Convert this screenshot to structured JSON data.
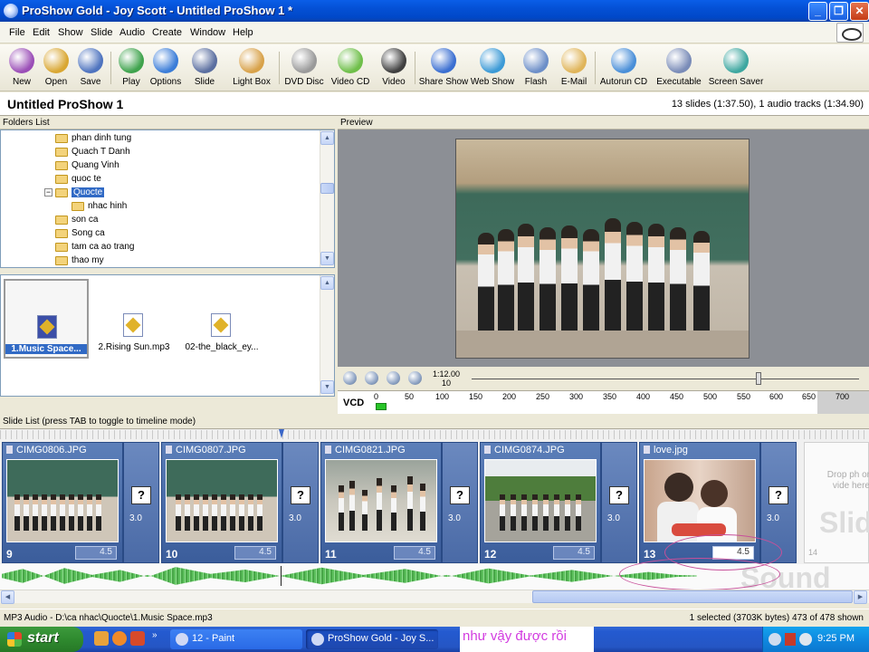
{
  "window": {
    "title": "ProShow Gold - Joy Scott - Untitled ProShow 1 *",
    "controls": [
      "_",
      "❐",
      "✕"
    ]
  },
  "menu": [
    "File",
    "Edit",
    "Show",
    "Slide",
    "Audio",
    "Create",
    "Window",
    "Help"
  ],
  "toolbar": [
    {
      "label": "New",
      "icon": "new-icon",
      "color": "#9b4fb7"
    },
    {
      "label": "Open",
      "icon": "open-folder-icon",
      "color": "#d9a733"
    },
    {
      "label": "Save",
      "icon": "save-icon",
      "color": "#4f74bf"
    },
    {
      "label": "Play",
      "icon": "play-icon",
      "color": "#3fa34d"
    },
    {
      "label": "Options",
      "icon": "options-globe-icon",
      "color": "#3b7dd8"
    },
    {
      "label": "Slide",
      "icon": "slide-filmstrip-icon",
      "color": "#5b6fa0"
    },
    {
      "label": "Light Box",
      "icon": "light-box-icon",
      "color": "#d8a24a"
    },
    {
      "label": "DVD Disc",
      "icon": "dvd-disc-icon",
      "color": "#9a9a9a"
    },
    {
      "label": "Video CD",
      "icon": "video-cd-icon",
      "color": "#6fbf4a"
    },
    {
      "label": "Video",
      "icon": "video-icon",
      "color": "#404040"
    },
    {
      "label": "Share Show",
      "icon": "share-show-icon",
      "color": "#3b6fd1"
    },
    {
      "label": "Web Show",
      "icon": "web-show-icon",
      "color": "#3c9ad6"
    },
    {
      "label": "Flash",
      "icon": "flash-icon",
      "color": "#6d8fc8"
    },
    {
      "label": "E-Mail",
      "icon": "email-icon",
      "color": "#e0b55a"
    },
    {
      "label": "Autorun CD",
      "icon": "autorun-cd-icon",
      "color": "#4a8fd8"
    },
    {
      "label": "Executable",
      "icon": "executable-icon",
      "color": "#7a8cb8"
    },
    {
      "label": "Screen Saver",
      "icon": "screen-saver-icon",
      "color": "#3ea7a0"
    }
  ],
  "show": {
    "title": "Untitled ProShow 1",
    "summary": "13 slides (1:37.50), 1 audio tracks (1:34.90)"
  },
  "folders_list": {
    "header": "Folders List",
    "items": [
      {
        "label": "phan dinh tung"
      },
      {
        "label": "Quach T Danh"
      },
      {
        "label": "Quang Vinh"
      },
      {
        "label": "quoc te"
      },
      {
        "label": "Quocte",
        "selected": true,
        "expanded": true
      },
      {
        "label": "nhac hinh",
        "child": true
      },
      {
        "label": "son ca"
      },
      {
        "label": "Song ca"
      },
      {
        "label": "tam ca ao trang"
      },
      {
        "label": "thao my"
      }
    ]
  },
  "files": [
    {
      "label": "1.Music Space...",
      "selected": true
    },
    {
      "label": "2.Rising Sun.mp3"
    },
    {
      "label": "02-the_black_ey..."
    }
  ],
  "preview": {
    "header": "Preview",
    "timecode_top": "1:12.00",
    "timecode_bottom": "10",
    "scrub_fraction": 0.74
  },
  "ruler": {
    "format": "VCD",
    "ticks": [
      "0",
      "50",
      "100",
      "150",
      "200",
      "250",
      "300",
      "350",
      "400",
      "450",
      "500",
      "550",
      "600",
      "650",
      "700"
    ]
  },
  "slide_list": {
    "header": "Slide List (press TAB to toggle to timeline mode)",
    "slides": [
      {
        "name": "CIMG0806.JPG",
        "number": "9",
        "duration": "4.5",
        "transition": "3.0"
      },
      {
        "name": "CIMG0807.JPG",
        "number": "10",
        "duration": "4.5",
        "transition": "3.0"
      },
      {
        "name": "CIMG0821.JPG",
        "number": "11",
        "duration": "4.5",
        "transition": "3.0"
      },
      {
        "name": "CIMG0874.JPG",
        "number": "12",
        "duration": "4.5",
        "transition": "3.0"
      },
      {
        "name": "love.jpg",
        "number": "13",
        "duration": "4.5",
        "transition": "3.0"
      }
    ],
    "next_number": "14",
    "drop_hint": "Drop ph or vide here",
    "slide_placeholder": "Slid",
    "sound_placeholder": "Sound"
  },
  "status": {
    "left": "MP3 Audio - D:\\ca nhac\\Quocte\\1.Music Space.mp3",
    "right": "1 selected (3703K bytes) 473 of 478 shown"
  },
  "taskbar": {
    "start": "start",
    "tasks": [
      {
        "label": "12 - Paint"
      },
      {
        "label": "ProShow Gold - Joy S..."
      }
    ],
    "annotation": "như vậy được rồi",
    "clock": "9:25 PM"
  }
}
